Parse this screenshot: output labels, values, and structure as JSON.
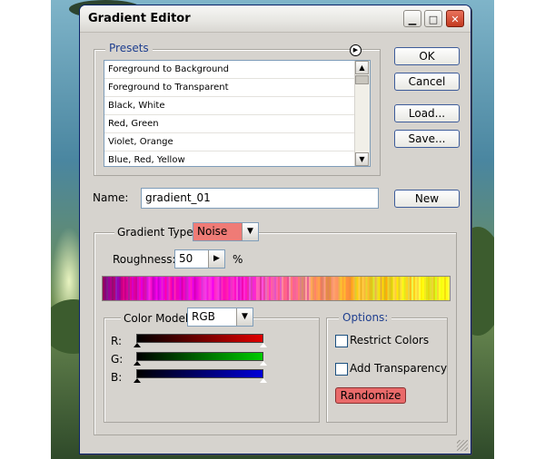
{
  "window": {
    "title": "Gradient Editor"
  },
  "presets": {
    "legend": "Presets",
    "menu_icon": "circle-arrow-icon",
    "items": [
      "Foreground to Background",
      "Foreground to Transparent",
      "Black, White",
      "Red, Green",
      "Violet, Orange",
      "Blue, Red, Yellow"
    ]
  },
  "buttons": {
    "ok": "OK",
    "cancel": "Cancel",
    "load": "Load...",
    "save": "Save...",
    "new": "New",
    "randomize": "Randomize"
  },
  "name_field": {
    "label": "Name:",
    "value": "gradient_01"
  },
  "gradient_type": {
    "label": "Gradient Type:",
    "value": "Noise"
  },
  "roughness": {
    "label": "Roughness:",
    "value": "50",
    "unit": "%"
  },
  "color_model": {
    "label": "Color Model:",
    "value": "RGB",
    "channels": [
      {
        "name": "R:",
        "color": "#e00000"
      },
      {
        "name": "G:",
        "color": "#00cc00"
      },
      {
        "name": "B:",
        "color": "#0000d8"
      }
    ]
  },
  "options": {
    "legend": "Options:",
    "restrict_colors": {
      "label": "Restrict Colors",
      "checked": false
    },
    "add_transparency": {
      "label": "Add Transparency",
      "checked": false
    }
  },
  "colors": {
    "dialog_bg": "#d6d3ce",
    "legend_text": "#1f3f8f",
    "noise_highlight": "#ef7b76",
    "randomize_bg": "#e96a6a"
  }
}
